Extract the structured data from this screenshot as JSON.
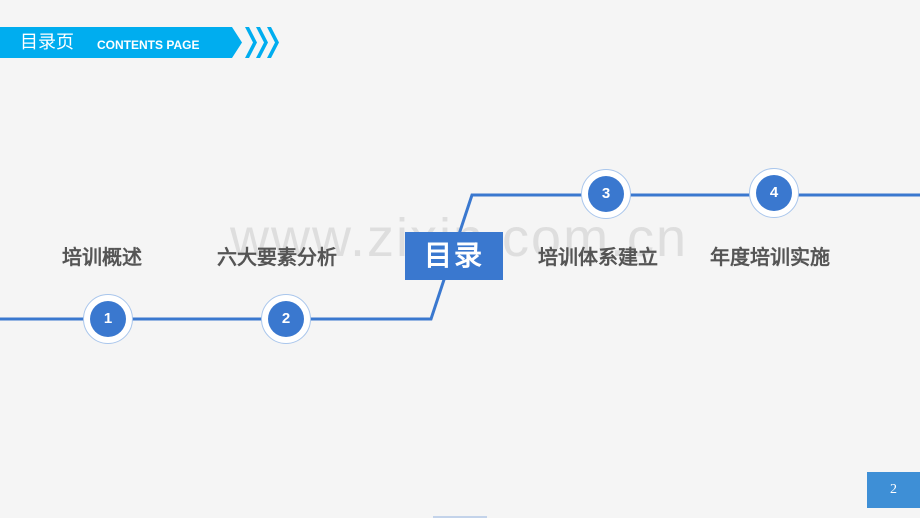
{
  "header": {
    "title_cn": "目录页",
    "title_en": "CONTENTS PAGE",
    "color": "#00adef"
  },
  "center": {
    "label": "目录",
    "color": "#3a78cf"
  },
  "items": [
    {
      "number": "1",
      "label": "培训概述"
    },
    {
      "number": "2",
      "label": "六大要素分析"
    },
    {
      "number": "3",
      "label": "培训体系建立"
    },
    {
      "number": "4",
      "label": "年度培训实施"
    }
  ],
  "watermark": "www.zixin.com.cn",
  "page_number": "2"
}
